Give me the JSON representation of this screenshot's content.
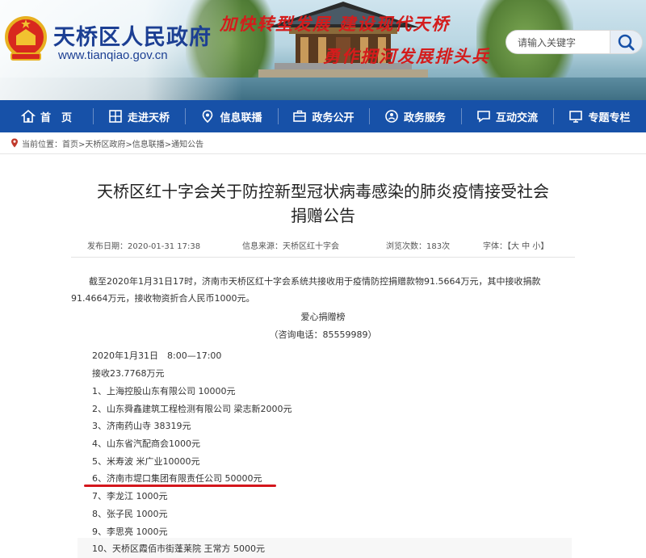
{
  "header": {
    "site_name": "天桥区人民政府",
    "site_url": "www.tianqiao.gov.cn",
    "slogan_line1": "加快转型发展 建设现代天桥",
    "slogan_line2": "勇作拥河发展排头兵",
    "search": {
      "placeholder": "请输入关键字"
    }
  },
  "nav": {
    "items": [
      {
        "label": "首　页",
        "icon": "home-icon"
      },
      {
        "label": "走进天桥",
        "icon": "grid-icon"
      },
      {
        "label": "信息联播",
        "icon": "location-icon"
      },
      {
        "label": "政务公开",
        "icon": "briefcase-icon"
      },
      {
        "label": "政务服务",
        "icon": "person-service-icon"
      },
      {
        "label": "互动交流",
        "icon": "chat-icon"
      },
      {
        "label": "专题专栏",
        "icon": "monitor-icon"
      }
    ]
  },
  "breadcrumb": {
    "text": "当前位置：首页>天桥区政府>信息联播>通知公告"
  },
  "article": {
    "title_line1": "天桥区红十字会关于防控新型冠状病毒感染的肺炎疫情接受社会",
    "title_line2": "捐赠公告",
    "meta": {
      "publish_date": "发布日期：2020-01-31 17:38",
      "source": "信息来源：天桥区红十字会",
      "views": "浏览次数：183次",
      "font_size": "字体：【大 中 小】"
    },
    "intro": "截至2020年1月31日17时，济南市天桥区红十字会系统共接收用于疫情防控捐赠款物91.5664万元，其中接收捐款91.4664万元，接收物资折合人民币1000元。",
    "board_title": "爱心捐赠榜",
    "hotline": "（咨询电话：85559989）",
    "date_line": "2020年1月31日　8:00—17:00",
    "received": "接收23.7768万元",
    "donors": [
      "1、上海控股山东有限公司 10000元",
      "2、山东舜鑫建筑工程检测有限公司 梁志新2000元",
      "3、济南药山寺 38319元",
      "4、山东省汽配商会1000元",
      "5、米寿波 米广业10000元",
      "6、济南市堤口集团有限责任公司 50000元",
      "7、李龙江 1000元",
      "8、张子民 1000元",
      "9、李思亮 1000元",
      "10、天桥区霞佰市街蓬莱院 王常方 5000元"
    ]
  },
  "colors": {
    "nav_bg": "#1751a8",
    "site_name": "#1c3f93",
    "slogan": "#d41c1c",
    "highlight_underline": "#d4161c"
  }
}
